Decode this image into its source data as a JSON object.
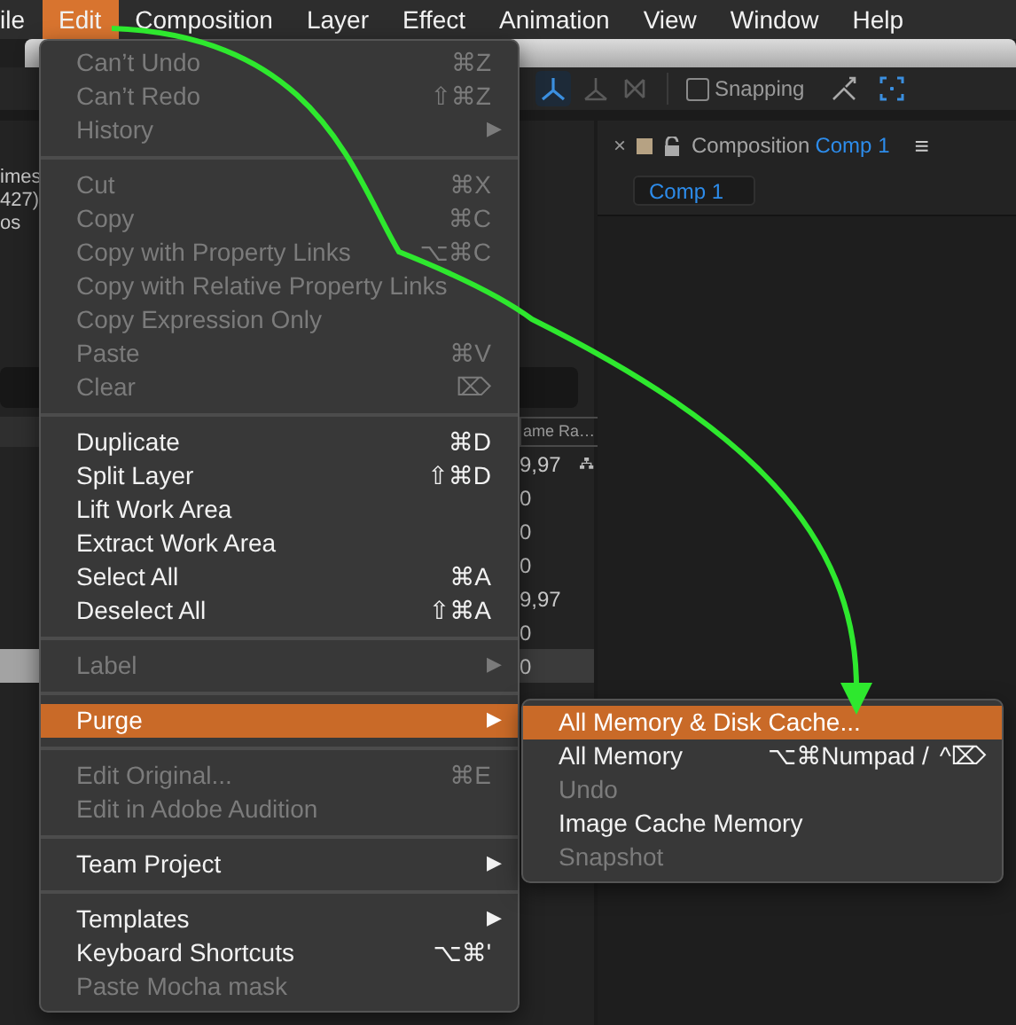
{
  "menubar": [
    {
      "label": "ile",
      "selected": false
    },
    {
      "label": "Edit",
      "selected": true
    },
    {
      "label": "Composition",
      "selected": false
    },
    {
      "label": "Layer",
      "selected": false
    },
    {
      "label": "Effect",
      "selected": false
    },
    {
      "label": "Animation",
      "selected": false
    },
    {
      "label": "View",
      "selected": false
    },
    {
      "label": "Window",
      "selected": false
    },
    {
      "label": "Help",
      "selected": false
    }
  ],
  "toolbar": {
    "snapping": {
      "label": "Snapping",
      "checked": false
    }
  },
  "project_panel": {
    "info": [
      "imes",
      "427)",
      "os"
    ],
    "column_header": "ame Ra…",
    "rows": [
      {
        "frame_rate": "9,97",
        "flowchart": true,
        "selected": false
      },
      {
        "frame_rate": "0",
        "flowchart": false,
        "selected": false
      },
      {
        "frame_rate": "0",
        "flowchart": false,
        "selected": false
      },
      {
        "frame_rate": "0",
        "flowchart": false,
        "selected": false
      },
      {
        "frame_rate": "9,97",
        "flowchart": false,
        "selected": false
      },
      {
        "frame_rate": "0",
        "flowchart": false,
        "selected": false
      },
      {
        "frame_rate": "0",
        "flowchart": false,
        "selected": true
      }
    ]
  },
  "composition_panel": {
    "close": "×",
    "title": "Composition",
    "comp_name": "Comp 1",
    "menu": "≡",
    "tab": "Comp 1"
  },
  "menu": {
    "items": [
      {
        "kind": "item",
        "label": "Can’t Undo",
        "shortcut": "⌘Z",
        "disabled": true,
        "selected": false
      },
      {
        "kind": "item",
        "label": "Can’t Redo",
        "shortcut": "⇧⌘Z",
        "disabled": true,
        "selected": false
      },
      {
        "kind": "item",
        "label": "History",
        "arrow": "▶",
        "disabled": true,
        "selected": false
      },
      {
        "kind": "separator"
      },
      {
        "kind": "item",
        "label": "Cut",
        "shortcut": "⌘X",
        "disabled": true,
        "selected": false
      },
      {
        "kind": "item",
        "label": "Copy",
        "shortcut": "⌘C",
        "disabled": true,
        "selected": false
      },
      {
        "kind": "item",
        "label": "Copy with Property Links",
        "shortcut": "⌥⌘C",
        "disabled": true,
        "selected": false
      },
      {
        "kind": "item",
        "label": "Copy with Relative Property Links",
        "disabled": true,
        "selected": false
      },
      {
        "kind": "item",
        "label": "Copy Expression Only",
        "disabled": true,
        "selected": false
      },
      {
        "kind": "item",
        "label": "Paste",
        "shortcut": "⌘V",
        "disabled": true,
        "selected": false
      },
      {
        "kind": "item",
        "label": "Clear",
        "shortcut": "⌦",
        "disabled": true,
        "selected": false
      },
      {
        "kind": "separator"
      },
      {
        "kind": "item",
        "label": "Duplicate",
        "shortcut": "⌘D",
        "disabled": false,
        "selected": false
      },
      {
        "kind": "item",
        "label": "Split Layer",
        "shortcut": "⇧⌘D",
        "disabled": false,
        "selected": false
      },
      {
        "kind": "item",
        "label": "Lift Work Area",
        "disabled": false,
        "selected": false
      },
      {
        "kind": "item",
        "label": "Extract Work Area",
        "disabled": false,
        "selected": false
      },
      {
        "kind": "item",
        "label": "Select All",
        "shortcut": "⌘A",
        "disabled": false,
        "selected": false
      },
      {
        "kind": "item",
        "label": "Deselect All",
        "shortcut": "⇧⌘A",
        "disabled": false,
        "selected": false
      },
      {
        "kind": "separator"
      },
      {
        "kind": "item",
        "label": "Label",
        "arrow": "▶",
        "disabled": true,
        "selected": false
      },
      {
        "kind": "separator"
      },
      {
        "kind": "item",
        "label": "Purge",
        "arrow": "▶",
        "disabled": false,
        "selected": true
      },
      {
        "kind": "separator"
      },
      {
        "kind": "item",
        "label": "Edit Original...",
        "shortcut": "⌘E",
        "disabled": true,
        "selected": false
      },
      {
        "kind": "item",
        "label": "Edit in Adobe Audition",
        "disabled": true,
        "selected": false
      },
      {
        "kind": "separator"
      },
      {
        "kind": "item",
        "label": "Team Project",
        "arrow": "▶",
        "disabled": false,
        "selected": false
      },
      {
        "kind": "separator"
      },
      {
        "kind": "item",
        "label": "Templates",
        "arrow": "▶",
        "disabled": false,
        "selected": false
      },
      {
        "kind": "item",
        "label": "Keyboard Shortcuts",
        "shortcut": "⌥⌘'",
        "disabled": false,
        "selected": false
      },
      {
        "kind": "item",
        "label": "Paste Mocha mask",
        "disabled": true,
        "selected": false
      }
    ]
  },
  "submenu": {
    "items": [
      {
        "kind": "item",
        "label": "All Memory & Disk Cache...",
        "disabled": false,
        "selected": true
      },
      {
        "kind": "item",
        "label": "All Memory",
        "shortcut": "⌥⌘Numpad /",
        "alt_shortcut": "^⌦",
        "disabled": false,
        "selected": false
      },
      {
        "kind": "item",
        "label": "Undo",
        "disabled": true,
        "selected": false
      },
      {
        "kind": "item",
        "label": "Image Cache Memory",
        "disabled": false,
        "selected": false
      },
      {
        "kind": "item",
        "label": "Snapshot",
        "disabled": true,
        "selected": false
      }
    ]
  }
}
